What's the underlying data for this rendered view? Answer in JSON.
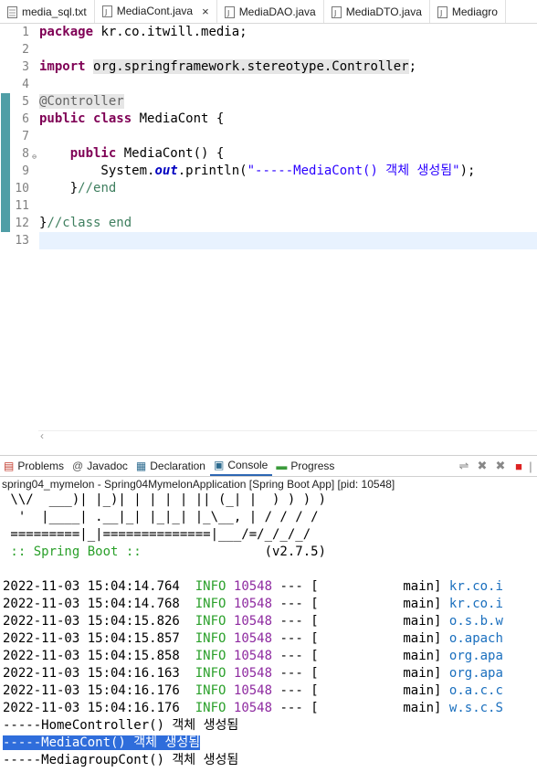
{
  "editor_tabs": [
    {
      "label": "media_sql.txt",
      "icon": "text-file-icon",
      "active": false
    },
    {
      "label": "MediaCont.java",
      "icon": "java-file-icon",
      "active": true,
      "close": "×"
    },
    {
      "label": "MediaDAO.java",
      "icon": "java-file-icon",
      "active": false
    },
    {
      "label": "MediaDTO.java",
      "icon": "java-file-icon",
      "active": false
    },
    {
      "label": "Mediagro",
      "icon": "java-file-icon",
      "active": false
    }
  ],
  "code": {
    "line_numbers": [
      "1",
      "2",
      "3",
      "4",
      "5",
      "6",
      "7",
      "8",
      "9",
      "10",
      "11",
      "12",
      "13"
    ],
    "l1_kw": "package",
    "l1_rest": " kr.co.itwill.media;",
    "l3_kw": "import",
    "l3_rest": "org.springframework.stereotype.Controller",
    "l3_semi": ";",
    "l5_ann": "@Controller",
    "l6_kw1": "public",
    "l6_kw2": "class",
    "l6_rest": " MediaCont {",
    "l8_indent": "    ",
    "l8_kw": "public",
    "l8_rest": " MediaCont() {",
    "l9_a": "        System.",
    "l9_fld": "out",
    "l9_b": ".println(",
    "l9_str": "\"-----MediaCont() 객체 생성됨\"",
    "l9_c": ");",
    "l10_a": "    }",
    "l10_cmt": "//end",
    "l12_a": "}",
    "l12_cmt": "//class end",
    "fold_marker": "⊖"
  },
  "view_tabs": [
    {
      "label": "Problems",
      "icon": "problems-icon",
      "glyph": "▤"
    },
    {
      "label": "Javadoc",
      "icon": "javadoc-icon",
      "glyph": "@"
    },
    {
      "label": "Declaration",
      "icon": "declaration-icon",
      "glyph": "▦"
    },
    {
      "label": "Console",
      "icon": "console-icon",
      "glyph": "▣",
      "active": true
    },
    {
      "label": "Progress",
      "icon": "progress-icon",
      "glyph": "▬"
    }
  ],
  "console": {
    "description": "spring04_mymelon - Spring04MymelonApplication [Spring Boot App]  [pid: 10548]",
    "banner": [
      " \\\\/  ___)| |_)| | | | | || (_| |  ) ) ) )",
      "  '  |____| .__|_| |_|_| |_\\__, | / / / /",
      " =========|_|==============|___/=/_/_/_/"
    ],
    "boot_label": " :: Spring Boot ::",
    "boot_version": "                (v2.7.5)",
    "logs": [
      {
        "ts": "2022-11-03 15:04:14.764",
        "level": "INFO",
        "pid": "10548",
        "sep": " --- [",
        "thread": "           main]",
        "logger": " kr.co.i"
      },
      {
        "ts": "2022-11-03 15:04:14.768",
        "level": "INFO",
        "pid": "10548",
        "sep": " --- [",
        "thread": "           main]",
        "logger": " kr.co.i"
      },
      {
        "ts": "2022-11-03 15:04:15.826",
        "level": "INFO",
        "pid": "10548",
        "sep": " --- [",
        "thread": "           main]",
        "logger": " o.s.b.w"
      },
      {
        "ts": "2022-11-03 15:04:15.857",
        "level": "INFO",
        "pid": "10548",
        "sep": " --- [",
        "thread": "           main]",
        "logger": " o.apach"
      },
      {
        "ts": "2022-11-03 15:04:15.858",
        "level": "INFO",
        "pid": "10548",
        "sep": " --- [",
        "thread": "           main]",
        "logger": " org.apa"
      },
      {
        "ts": "2022-11-03 15:04:16.163",
        "level": "INFO",
        "pid": "10548",
        "sep": " --- [",
        "thread": "           main]",
        "logger": " org.apa"
      },
      {
        "ts": "2022-11-03 15:04:16.176",
        "level": "INFO",
        "pid": "10548",
        "sep": " --- [",
        "thread": "           main]",
        "logger": " o.a.c.c"
      },
      {
        "ts": "2022-11-03 15:04:16.176",
        "level": "INFO",
        "pid": "10548",
        "sep": " --- [",
        "thread": "           main]",
        "logger": " w.s.c.S"
      }
    ],
    "out1": "-----HomeController() 객체 생성됨",
    "out2": "-----MediaCont() 객체 생성됨",
    "out3": "-----MediagroupCont() 객체 생성됨"
  },
  "colors": {
    "keyword": "#7f0055",
    "string": "#2a00ff",
    "comment": "#3f7f5f",
    "info": "#2aa02a",
    "pid": "#8e2aa0",
    "selection": "#2f6ddb"
  }
}
